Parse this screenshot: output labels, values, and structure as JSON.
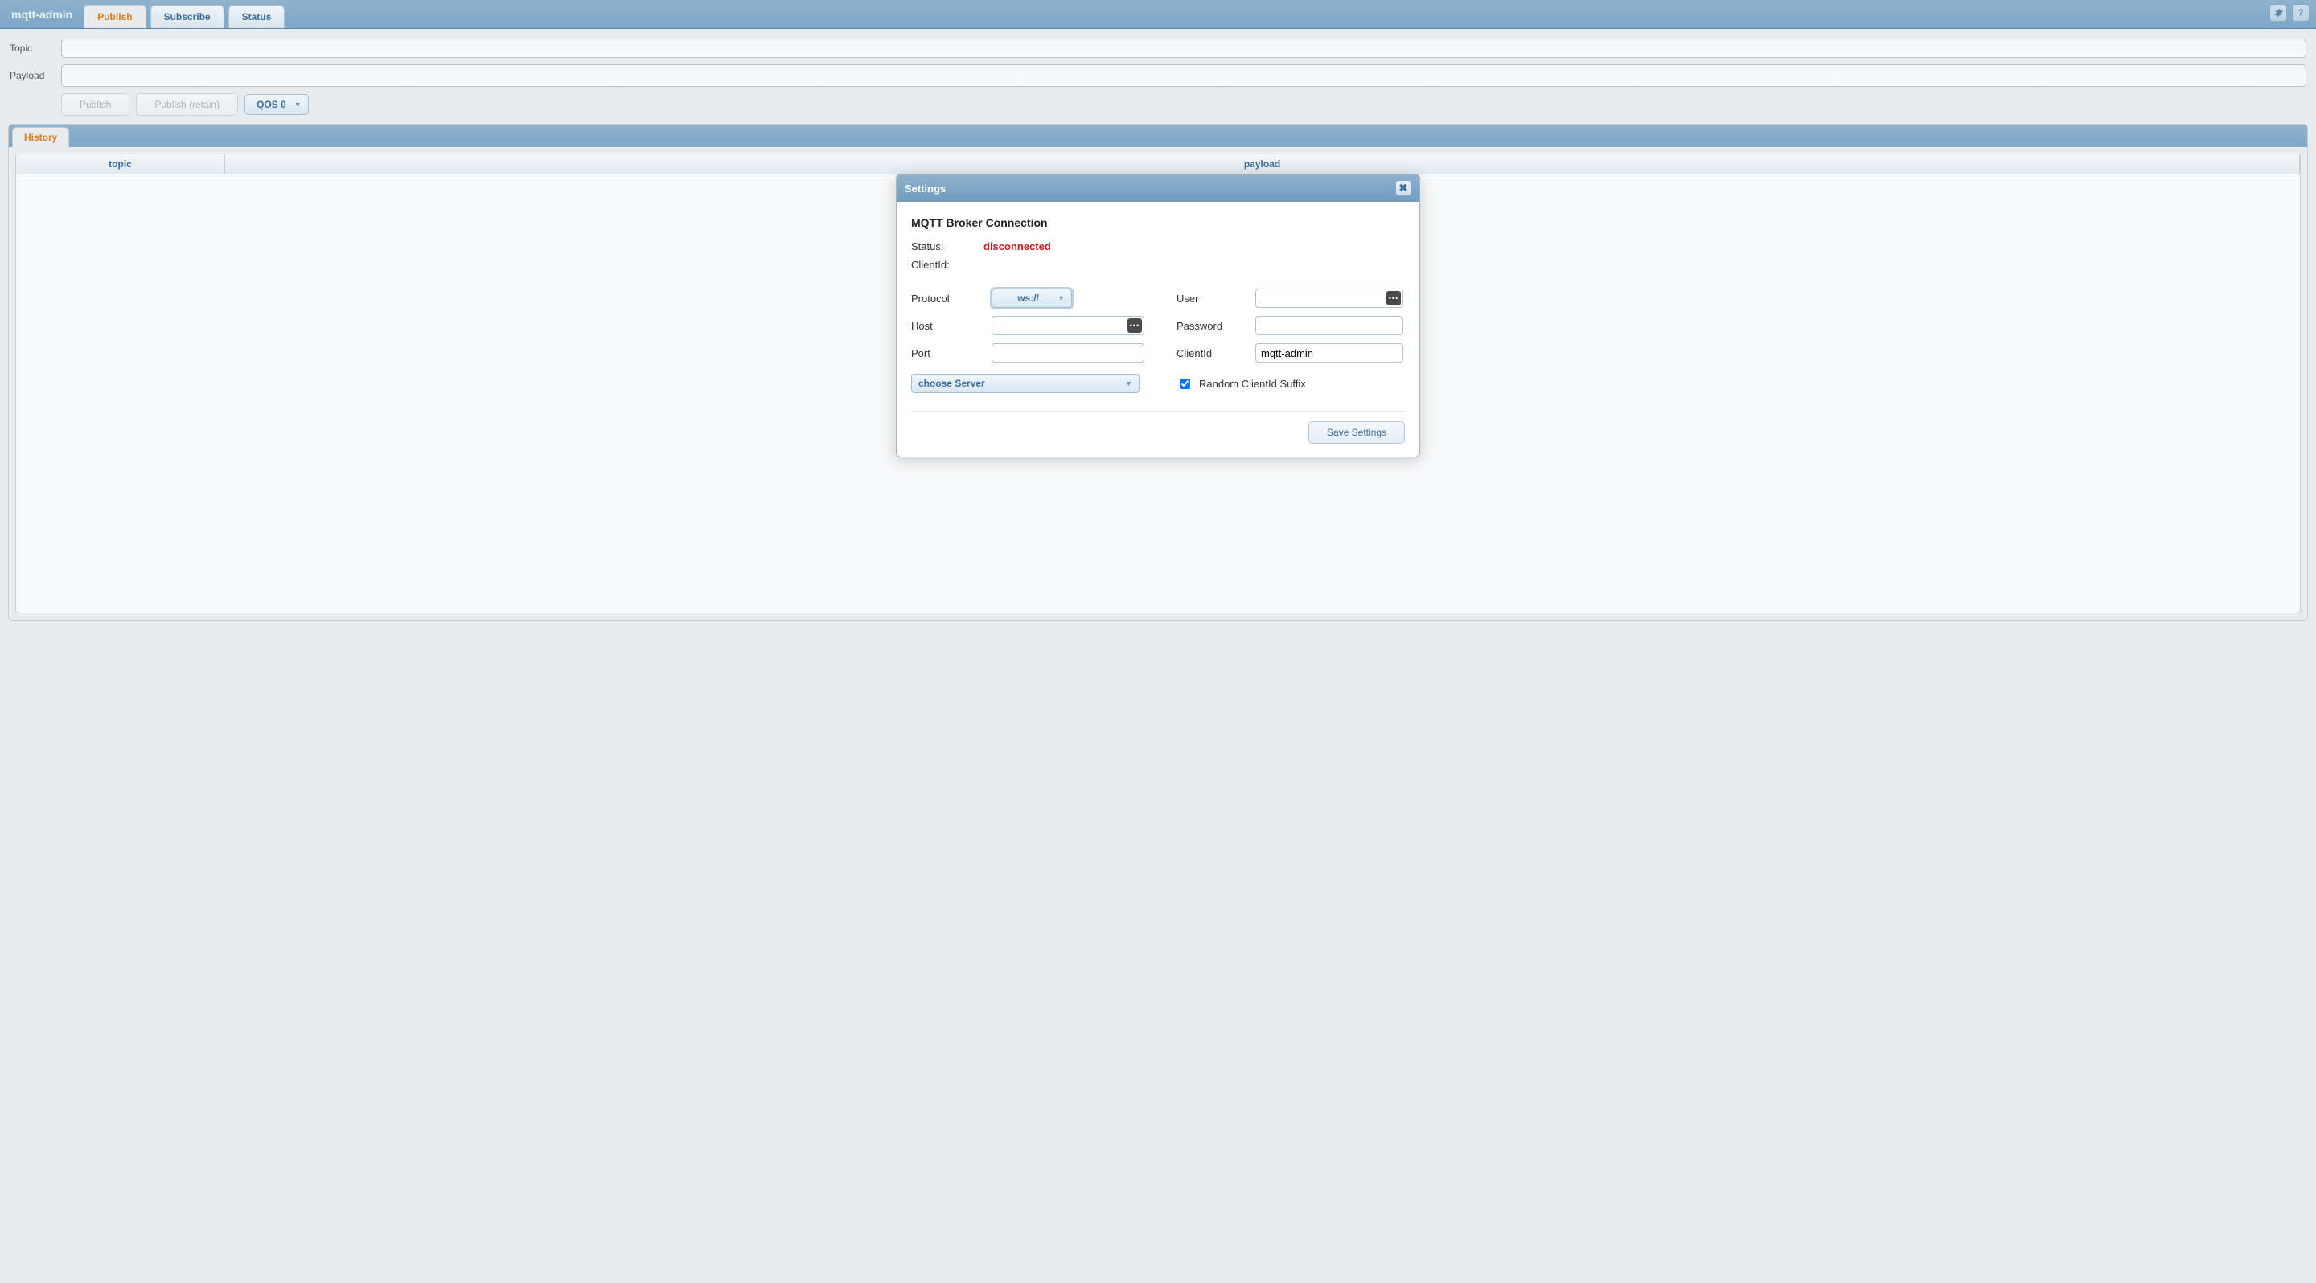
{
  "app": {
    "title": "mqtt-admin"
  },
  "tabs": {
    "publish": "Publish",
    "subscribe": "Subscribe",
    "status": "Status",
    "active": "publish"
  },
  "toolbar_icons": {
    "settings": "gear",
    "help": "?"
  },
  "publish": {
    "topic_label": "Topic",
    "payload_label": "Payload",
    "topic_value": "",
    "payload_value": "",
    "btn_publish": "Publish",
    "btn_publish_retain": "Publish (retain)",
    "qos_label": "QOS 0"
  },
  "history": {
    "tab_label": "History",
    "columns": {
      "topic": "topic",
      "payload": "payload"
    }
  },
  "dialog": {
    "title": "Settings",
    "heading": "MQTT Broker Connection",
    "status_label": "Status:",
    "status_value": "disconnected",
    "clientid_status_label": "ClientId:",
    "clientid_status_value": "",
    "fields": {
      "protocol_label": "Protocol",
      "protocol_value": "ws://",
      "host_label": "Host",
      "host_value": "",
      "port_label": "Port",
      "port_value": "",
      "user_label": "User",
      "user_value": "",
      "password_label": "Password",
      "password_value": "",
      "clientid_label": "ClientId",
      "clientid_value": "mqtt-admin"
    },
    "choose_server_label": "choose Server",
    "random_suffix_label": "Random ClientId Suffix",
    "random_suffix_checked": true,
    "save_button": "Save Settings"
  }
}
